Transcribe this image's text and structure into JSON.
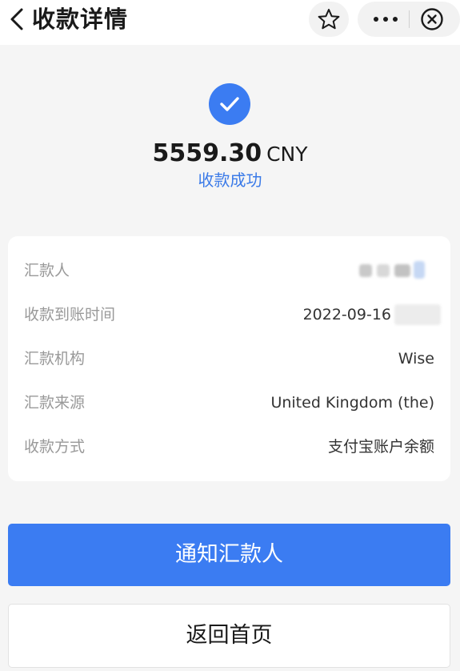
{
  "header": {
    "title": "收款详情",
    "back_icon": "chevron-left-icon",
    "favorite_icon": "star-icon",
    "more_icon": "more-dots-icon",
    "close_icon": "close-circle-icon"
  },
  "summary": {
    "status_icon": "check-circle-icon",
    "amount": "5559.30",
    "currency": "CNY",
    "status_text": "收款成功"
  },
  "details": {
    "rows": [
      {
        "label": "汇款人",
        "value": ""
      },
      {
        "label": "收款到账时间",
        "value": "2022-09-16"
      },
      {
        "label": "汇款机构",
        "value": "Wise"
      },
      {
        "label": "汇款来源",
        "value": "United Kingdom (the)"
      },
      {
        "label": "收款方式",
        "value": "支付宝账户余额"
      }
    ]
  },
  "actions": {
    "notify_label": "通知汇款人",
    "home_label": "返回首页"
  },
  "colors": {
    "accent": "#3b7cf2",
    "status_text": "#3a7ae8",
    "label_gray": "#999999",
    "background": "#f5f5f5"
  }
}
